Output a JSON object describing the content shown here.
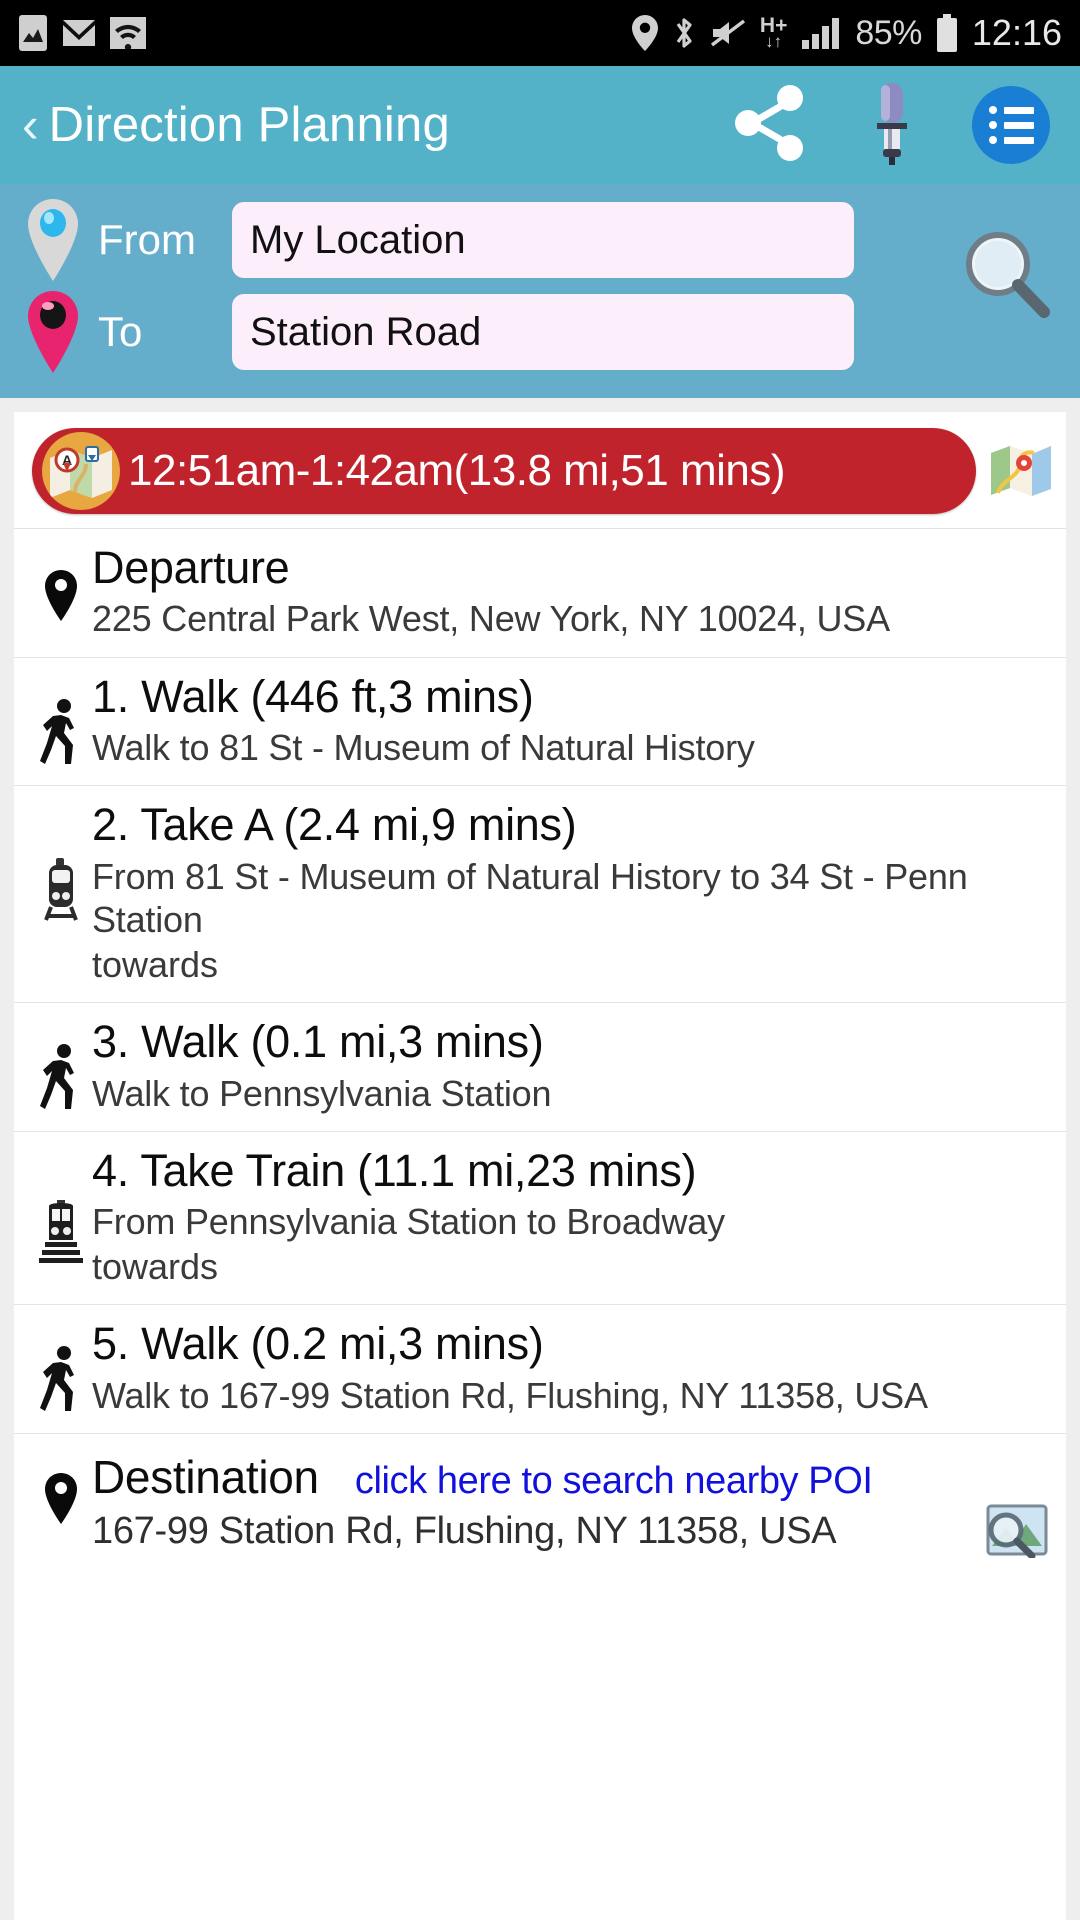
{
  "status_bar": {
    "icons_left": [
      "screenshot-icon",
      "gmail-icon",
      "wifi-icon"
    ],
    "icons_right": [
      "location-icon",
      "bluetooth-icon",
      "mute-icon",
      "hplus-data-icon",
      "signal-icon"
    ],
    "network_type": "H+",
    "battery_percent": "85%",
    "time": "12:16"
  },
  "app_bar": {
    "back_label": "‹",
    "title": "Direction Planning",
    "share_icon": "share-icon",
    "mic_icon": "microphone-icon",
    "menu_icon": "list-menu-icon"
  },
  "search_panel": {
    "from_label": "From",
    "from_value": "My Location",
    "from_placeholder": "My Location",
    "to_label": "To",
    "to_value": "Station Road",
    "to_placeholder": "To",
    "search_icon": "magnifier-icon",
    "from_pin_color": "#29b6e8",
    "to_pin_color": "#e8246e"
  },
  "summary": {
    "badge_icon": "map-route-badge-icon",
    "text": "12:51am-1:42am(13.8 mi,51 mins)",
    "map_icon": "google-maps-icon",
    "banner_color": "#c0232b",
    "start_time": "12:51am",
    "end_time": "1:42am",
    "distance": "13.8 mi",
    "duration": "51 mins"
  },
  "departure": {
    "icon": "map-pin-icon",
    "title": "Departure",
    "address": "225 Central Park West, New York, NY 10024, USA"
  },
  "steps": [
    {
      "icon": "walking-icon",
      "title": "1. Walk (446 ft,3 mins)",
      "sub": "Walk to 81 St - Museum of Natural History",
      "towards": "",
      "mode": "walk"
    },
    {
      "icon": "subway-icon",
      "title": "2. Take A (2.4 mi,9 mins)",
      "sub": "From 81 St - Museum of Natural History to 34 St - Penn Station",
      "towards": "towards",
      "mode": "transit"
    },
    {
      "icon": "walking-icon",
      "title": "3. Walk (0.1 mi,3 mins)",
      "sub": "Walk to Pennsylvania Station",
      "towards": "",
      "mode": "walk"
    },
    {
      "icon": "train-icon",
      "title": "4. Take Train (11.1 mi,23 mins)",
      "sub": "From Pennsylvania Station to Broadway",
      "towards": "towards",
      "mode": "train"
    },
    {
      "icon": "walking-icon",
      "title": "5. Walk (0.2 mi,3 mins)",
      "sub": "Walk to 167-99 Station Rd, Flushing, NY 11358, USA",
      "towards": "",
      "mode": "walk"
    }
  ],
  "destination": {
    "icon": "map-pin-icon",
    "title": "Destination",
    "poi_link": "click here to search nearby POI",
    "address": "167-99 Station Rd, Flushing, NY 11358, USA",
    "search_icon": "image-search-icon",
    "link_color": "#1111dd"
  }
}
